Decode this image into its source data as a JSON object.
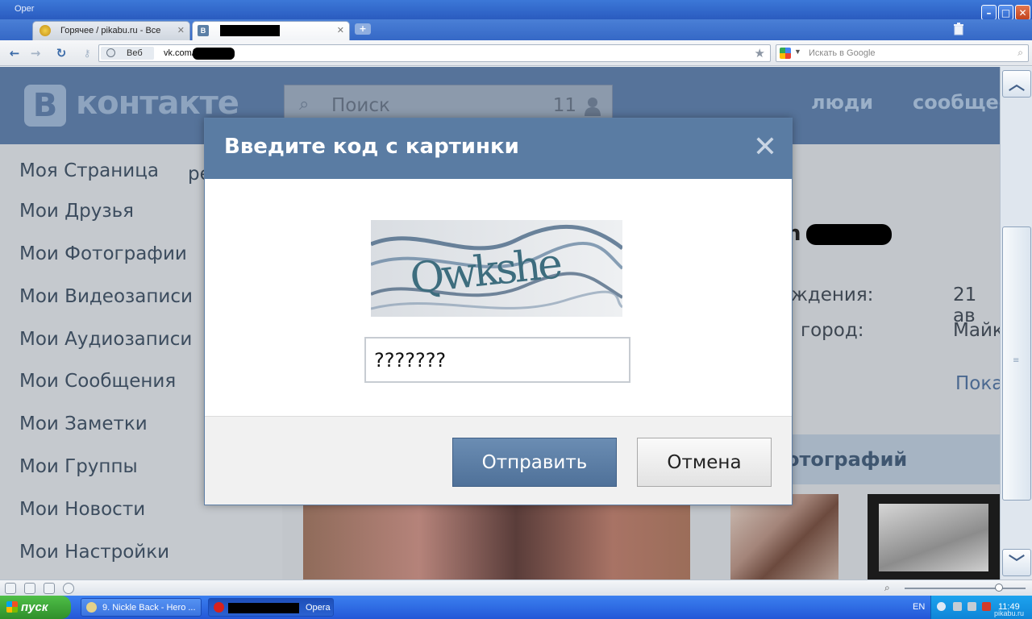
{
  "window": {
    "title": "Oper"
  },
  "tabs": [
    {
      "label": "Горячее / pikabu.ru - Все"
    },
    {
      "label": ""
    }
  ],
  "addressbar": {
    "scope_label": "Веб",
    "url": "vk.com/",
    "search_placeholder": "Искать в Google"
  },
  "vk": {
    "logo_letter": "В",
    "logo_text": "контакте",
    "search_placeholder": "Поиск",
    "search_count": "11",
    "nav": [
      "люди",
      "сообщест"
    ],
    "menu": [
      "Моя Страница",
      "Мои Друзья",
      "Мои Фотографии",
      "Мои Видеозаписи",
      "Мои Аудиозаписи",
      "Мои Сообщения",
      "Мои Заметки",
      "Мои Группы",
      "Мои Новости",
      "Мои Настройки"
    ],
    "menu_extra": "ре",
    "profile_name_initial": "n",
    "info": {
      "birth_label": "ождения:",
      "birth_value": "21 ав",
      "city_label": "город:",
      "city_value": "Майк",
      "show_more": "Пока"
    },
    "photos_title": "отографий"
  },
  "dialog": {
    "title": "Введите код с картинки",
    "captcha_text": "Qwkshe",
    "input_value": "???????",
    "send_label": "Отправить",
    "cancel_label": "Отмена"
  },
  "taskbar": {
    "start_label": "пуск",
    "tasks": [
      "9. Nickle Back - Hero ...",
      "Opera"
    ],
    "lang": "EN",
    "clock": "11:49"
  },
  "watermark": "pikabu.ru",
  "colors": {
    "vk_header": "#56739a",
    "dialog_header": "#5a7ca3",
    "send_button": "#5b7ea6"
  }
}
